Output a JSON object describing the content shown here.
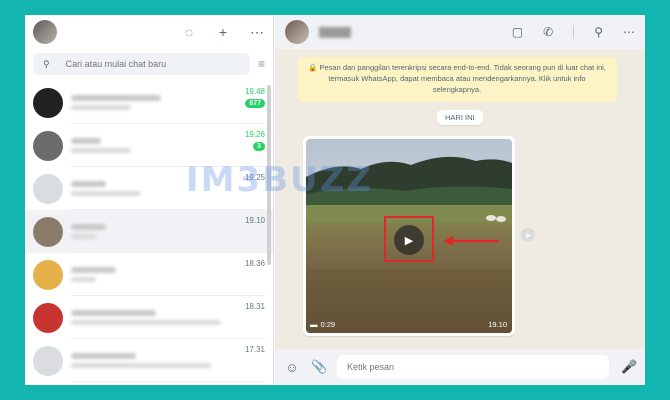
{
  "search": {
    "placeholder": "Cari atau mulai chat baru"
  },
  "chats": [
    {
      "time": "19.48",
      "badge": "677",
      "unread": true,
      "avatar": "#2a2a2a"
    },
    {
      "time": "19.26",
      "badge": "3",
      "unread": true,
      "avatar": "#6b6b6b"
    },
    {
      "time": "19.25",
      "badge": "",
      "unread": false,
      "avatar": "#d9dde0"
    },
    {
      "time": "19.10",
      "badge": "",
      "unread": false,
      "avatar": "#8a7a6a"
    },
    {
      "time": "18.36",
      "badge": "",
      "unread": false,
      "avatar": "#e6b04a"
    },
    {
      "time": "18.31",
      "badge": "",
      "unread": false,
      "avatar": "#c8342f"
    },
    {
      "time": "17.31",
      "badge": "",
      "unread": false,
      "avatar": "#d9dde0"
    }
  ],
  "encryption_notice": "🔒 Pesan dan panggilan terenkripsi secara end-to-end. Tidak seorang pun di luar chat ini, termasuk WhatsApp, dapat membaca atau mendengarkannya. Klik untuk info selengkapnya.",
  "day_chip": "HARI INI",
  "video": {
    "duration": "0:29",
    "time": "19.10"
  },
  "composer": {
    "placeholder": "Ketik pesan"
  },
  "watermark": "IM3BUZZ",
  "colors": {
    "accent": "#25d366",
    "annotation": "#e0282b",
    "frame": "#13b5b1"
  }
}
